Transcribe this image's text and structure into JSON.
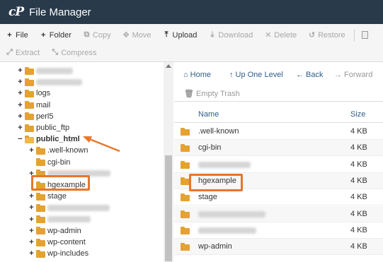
{
  "header": {
    "logo_text": "cP",
    "title": "File Manager"
  },
  "toolbar": {
    "row1": [
      {
        "icon": "plus-icon",
        "glyph": "+",
        "label": "File",
        "enabled": true
      },
      {
        "icon": "plus-icon",
        "glyph": "+",
        "label": "Folder",
        "enabled": true
      },
      {
        "icon": "copy-icon",
        "glyph": "⧉",
        "label": "Copy",
        "enabled": false
      },
      {
        "icon": "move-icon",
        "glyph": "✥",
        "label": "Move",
        "enabled": false
      },
      {
        "icon": "upload-icon",
        "glyph": "⤒",
        "label": "Upload",
        "enabled": true
      },
      {
        "icon": "download-icon",
        "glyph": "⤓",
        "label": "Download",
        "enabled": false
      },
      {
        "icon": "close-icon",
        "glyph": "✕",
        "label": "Delete",
        "enabled": false
      },
      {
        "icon": "restore-icon",
        "glyph": "↺",
        "label": "Restore",
        "enabled": false
      }
    ],
    "row2": [
      {
        "icon": "extract-icon",
        "glyph": "⤢",
        "label": "Extract",
        "enabled": false
      },
      {
        "icon": "compress-icon",
        "glyph": "⤡",
        "label": "Compress",
        "enabled": false
      }
    ]
  },
  "tree": [
    {
      "label": "",
      "blurred": true,
      "toggle": "+",
      "open": false
    },
    {
      "label": "",
      "blurred": true,
      "toggle": "+",
      "open": false
    },
    {
      "label": "logs",
      "blurred": false,
      "toggle": "+",
      "open": false
    },
    {
      "label": "mail",
      "blurred": false,
      "toggle": "+",
      "open": false
    },
    {
      "label": "perl5",
      "blurred": false,
      "toggle": "+",
      "open": false
    },
    {
      "label": "public_ftp",
      "blurred": false,
      "toggle": "+",
      "open": false
    },
    {
      "label": "public_html",
      "blurred": false,
      "toggle": "−",
      "open": true,
      "bold": true
    },
    {
      "label": ".well-known",
      "blurred": false,
      "toggle": "+",
      "open": false
    },
    {
      "label": "cgi-bin",
      "blurred": false,
      "toggle": "",
      "open": false
    },
    {
      "label": "",
      "blurred": true,
      "toggle": "+",
      "open": false
    },
    {
      "label": "hgexample",
      "blurred": false,
      "toggle": "",
      "open": false,
      "highlight": true
    },
    {
      "label": "stage",
      "blurred": false,
      "toggle": "+",
      "open": false
    },
    {
      "label": "",
      "blurred": true,
      "toggle": "+",
      "open": false
    },
    {
      "label": "",
      "blurred": true,
      "toggle": "+",
      "open": false
    },
    {
      "label": "wp-admin",
      "blurred": false,
      "toggle": "+",
      "open": false
    },
    {
      "label": "wp-content",
      "blurred": false,
      "toggle": "+",
      "open": false
    },
    {
      "label": "wp-includes",
      "blurred": false,
      "toggle": "+",
      "open": false
    }
  ],
  "nav": {
    "home": "Home",
    "up_one_level": "Up One Level",
    "back": "Back",
    "forward": "Forward",
    "empty_trash": "Empty Trash"
  },
  "table": {
    "columns": {
      "name": "Name",
      "size": "Size"
    },
    "rows": [
      {
        "name": ".well-known",
        "size": "4 KB",
        "blurred": false
      },
      {
        "name": "cgi-bin",
        "size": "4 KB",
        "blurred": false
      },
      {
        "name": "",
        "size": "4 KB",
        "blurred": true
      },
      {
        "name": "hgexample",
        "size": "4 KB",
        "blurred": false,
        "highlight": true
      },
      {
        "name": "stage",
        "size": "4 KB",
        "blurred": false
      },
      {
        "name": "",
        "size": "4 KB",
        "blurred": true
      },
      {
        "name": "",
        "size": "4 KB",
        "blurred": true
      },
      {
        "name": "wp-admin",
        "size": "4 KB",
        "blurred": false
      }
    ]
  },
  "colors": {
    "header_bg": "#293a4a",
    "folder": "#e4a232",
    "highlight": "#e8762b",
    "link": "#2f5d89"
  }
}
